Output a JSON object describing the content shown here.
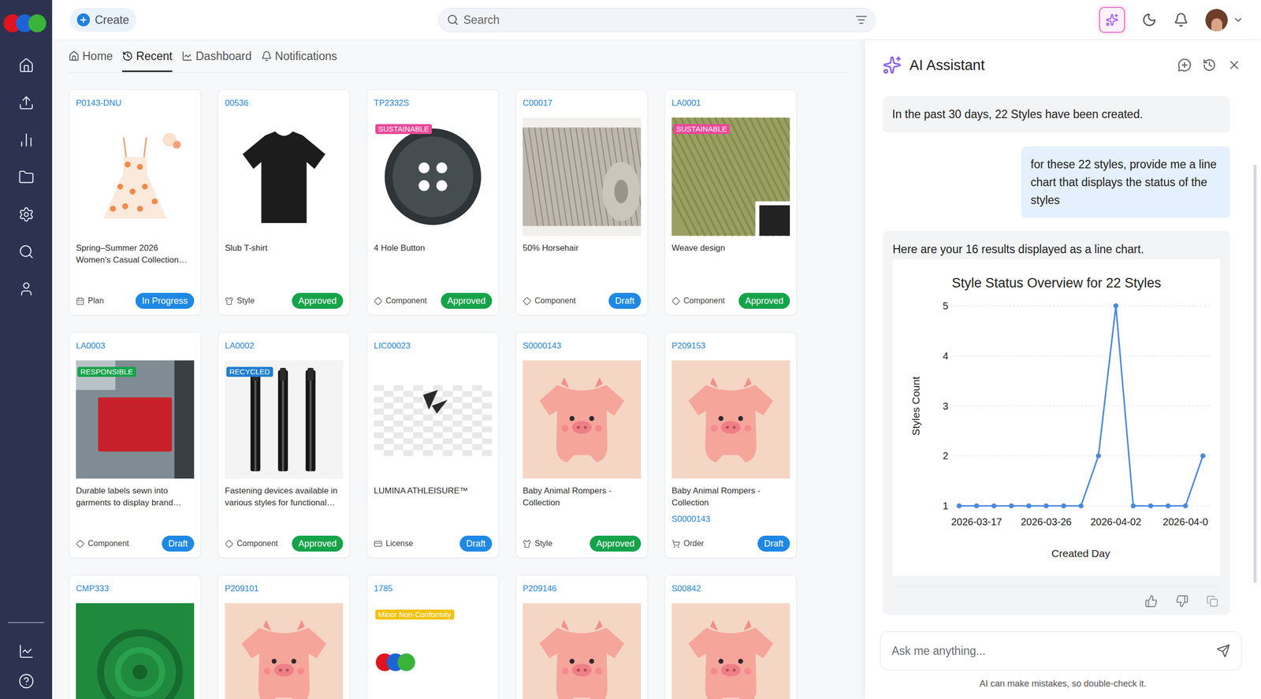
{
  "topbar": {
    "create": "Create",
    "search_placeholder": "Search",
    "assistant_open": true
  },
  "nav_tabs": [
    {
      "label": "Home",
      "selected": false
    },
    {
      "label": "Recent",
      "selected": true
    },
    {
      "label": "Dashboard",
      "selected": false
    },
    {
      "label": "Notifications",
      "selected": false
    }
  ],
  "cards": [
    {
      "code": "P0143-DNU",
      "title": "Spring–Summer 2026 Women's Casual Collection…",
      "kind": "plan",
      "type": "Plan",
      "status": {
        "label": "In Progress",
        "color": "#1e88e5"
      }
    },
    {
      "code": "00536",
      "title": "Slub T-shirt",
      "kind": "style",
      "type": "Style",
      "status": {
        "label": "Approved",
        "color": "#15a34a"
      }
    },
    {
      "code": "TP2332S",
      "tag": {
        "label": "SUSTAINABLE",
        "color": "#ec4899"
      },
      "title": "4 Hole Button",
      "kind": "component",
      "type": "Component",
      "status": {
        "label": "Approved",
        "color": "#15a34a"
      }
    },
    {
      "code": "C00017",
      "title": "50% Horsehair",
      "kind": "component",
      "type": "Component",
      "status": {
        "label": "Draft",
        "color": "#1e88e5"
      }
    },
    {
      "code": "LA0001",
      "tag": {
        "label": "SUSTAINABLE",
        "color": "#ec4899"
      },
      "title": "Weave design",
      "kind": "component",
      "type": "Component",
      "status": {
        "label": "Approved",
        "color": "#15a34a"
      }
    },
    {
      "code": "LA0003",
      "tag": {
        "label": "RESPONSIBLE",
        "color": "#16a34a"
      },
      "title": "Durable labels sewn into garments to display brand…",
      "kind": "component",
      "type": "Component",
      "status": {
        "label": "Draft",
        "color": "#1e88e5"
      }
    },
    {
      "code": "LA0002",
      "tag": {
        "label": "RECYCLED",
        "color": "#1d7fd1"
      },
      "title": "Fastening devices available in various styles for functional…",
      "kind": "component",
      "type": "Component",
      "status": {
        "label": "Approved",
        "color": "#15a34a"
      }
    },
    {
      "code": "LIC00023",
      "title": "LUMINA ATHLEISURE™",
      "kind": "license",
      "type": "License",
      "status": {
        "label": "Draft",
        "color": "#1e88e5"
      }
    },
    {
      "code": "S0000143",
      "title": "Baby Animal Rompers - Collection",
      "kind": "style",
      "type": "Style",
      "status": {
        "label": "Approved",
        "color": "#15a34a"
      }
    },
    {
      "code": "P209153",
      "title": "Baby Animal Rompers - Collection",
      "link": "S0000143",
      "kind": "order",
      "type": "Order",
      "status": {
        "label": "Draft",
        "color": "#1e88e5"
      }
    },
    {
      "code": "CMP333"
    },
    {
      "code": "P209101"
    },
    {
      "code": "1785",
      "tag": {
        "label": "Minor Non-Conformity",
        "color": "#f2c20f"
      }
    },
    {
      "code": "P209146"
    },
    {
      "code": "S00842"
    }
  ],
  "assistant": {
    "title": "AI Assistant",
    "messages": [
      {
        "role": "assistant",
        "text": "In the past 30 days, 22 Styles have been created."
      },
      {
        "role": "user",
        "text": "for these 22 styles, provide me a line chart that displays the status of the styles"
      },
      {
        "role": "assistant",
        "text": "Here are your 16 results displayed as a line chart.",
        "chart": {
          "title": "Style Status Overview for 22 Styles",
          "y_label": "Styles Count",
          "x_label": "Created Day",
          "y_ticks": [
            "1",
            "2",
            "3",
            "4",
            "5"
          ],
          "x_ticks": [
            {
              "label": "2026-03-17",
              "at": 1
            },
            {
              "label": "2026-03-26",
              "at": 5
            },
            {
              "label": "2026-04-02",
              "at": 9
            },
            {
              "label": "2026-04-0",
              "at": 13
            }
          ],
          "values": [
            1,
            1,
            1,
            1,
            1,
            1,
            1,
            1,
            2,
            5,
            1,
            1,
            1,
            1,
            2
          ]
        }
      }
    ],
    "input_placeholder": "Ask me anything...",
    "disclaimer": "AI can make mistakes, so double-check it."
  }
}
